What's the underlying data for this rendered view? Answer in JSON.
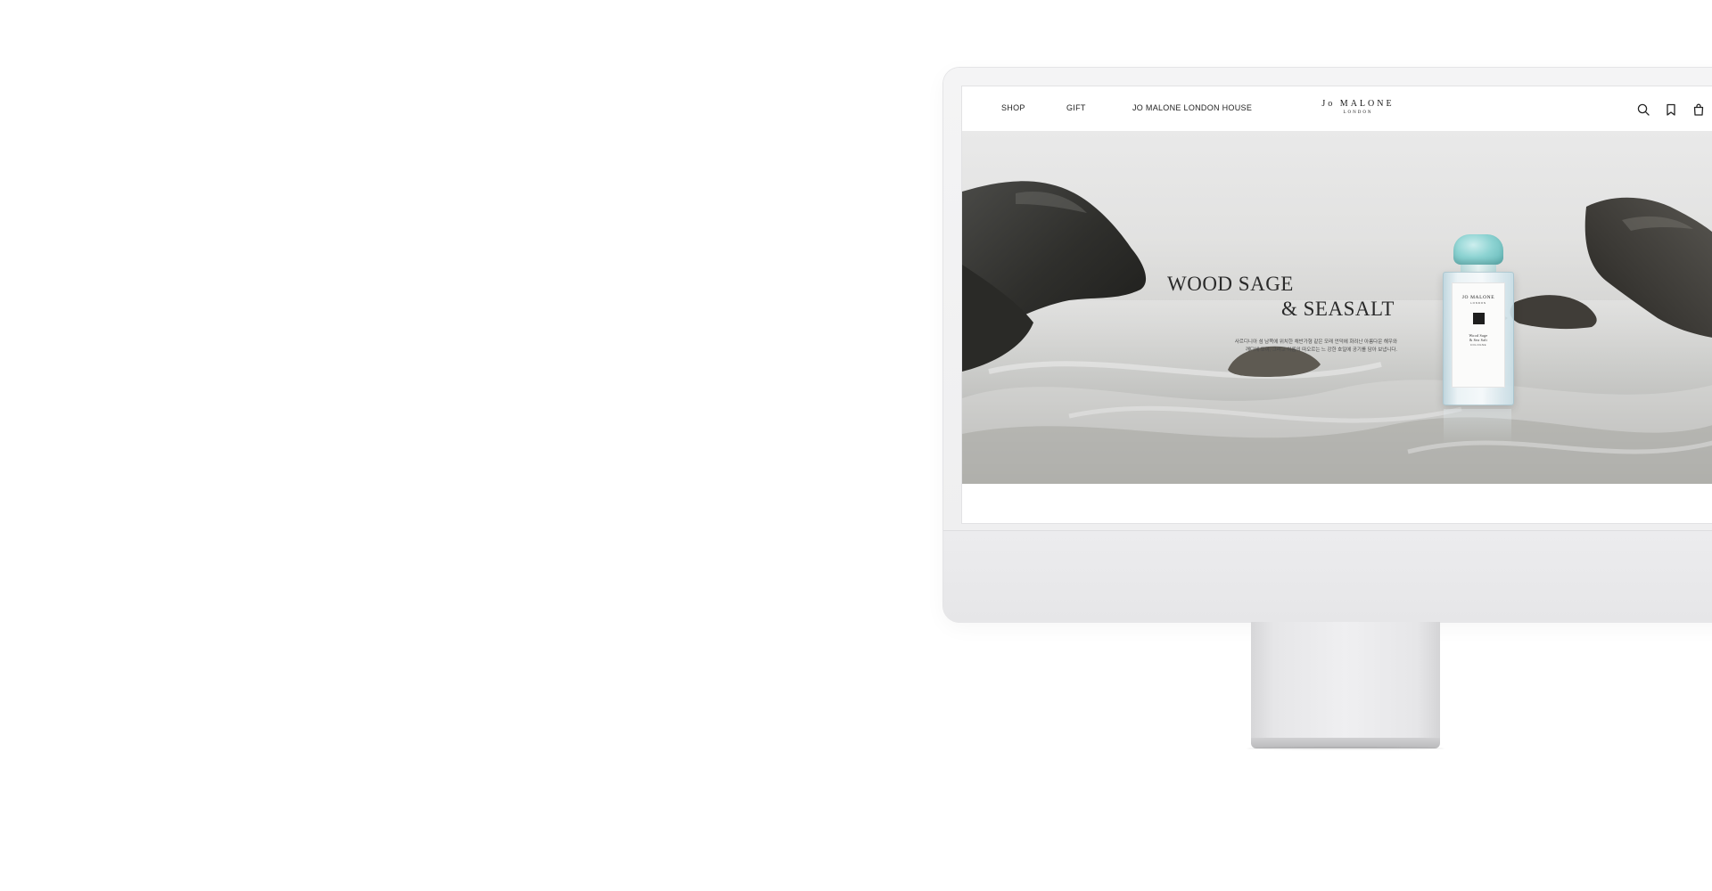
{
  "nav": {
    "shop": "SHOP",
    "gift": "GIFT",
    "house": "JO MALONE LONDON HOUSE"
  },
  "logo": {
    "main": "Jo MALONE",
    "sub": "LONDON"
  },
  "icons": {
    "search": "search-icon",
    "bookmark": "bookmark-icon",
    "bag": "shopping-bag-icon"
  },
  "hero": {
    "title_line1": "WOOD SAGE",
    "title_line2": "& SEASALT",
    "description_line1": "사르디니아 섬 남쪽에 위치한 채반가형 같은 모래 언덕에 화려난 아름다운 해우와",
    "description_line2": "깨디에 모여, 그리고 여름의 따오르는 느 강한 호일에 공기를 담아 보냅니다."
  },
  "bottle_label": {
    "brand": "JO MALONE",
    "city": "LONDON",
    "name_line1": "Wood Sage",
    "name_line2": "& Sea Salt",
    "type": "COLOGNE"
  },
  "colors": {
    "cap": "#8dd3d2",
    "text": "#222222",
    "device": "#eeeeef"
  }
}
